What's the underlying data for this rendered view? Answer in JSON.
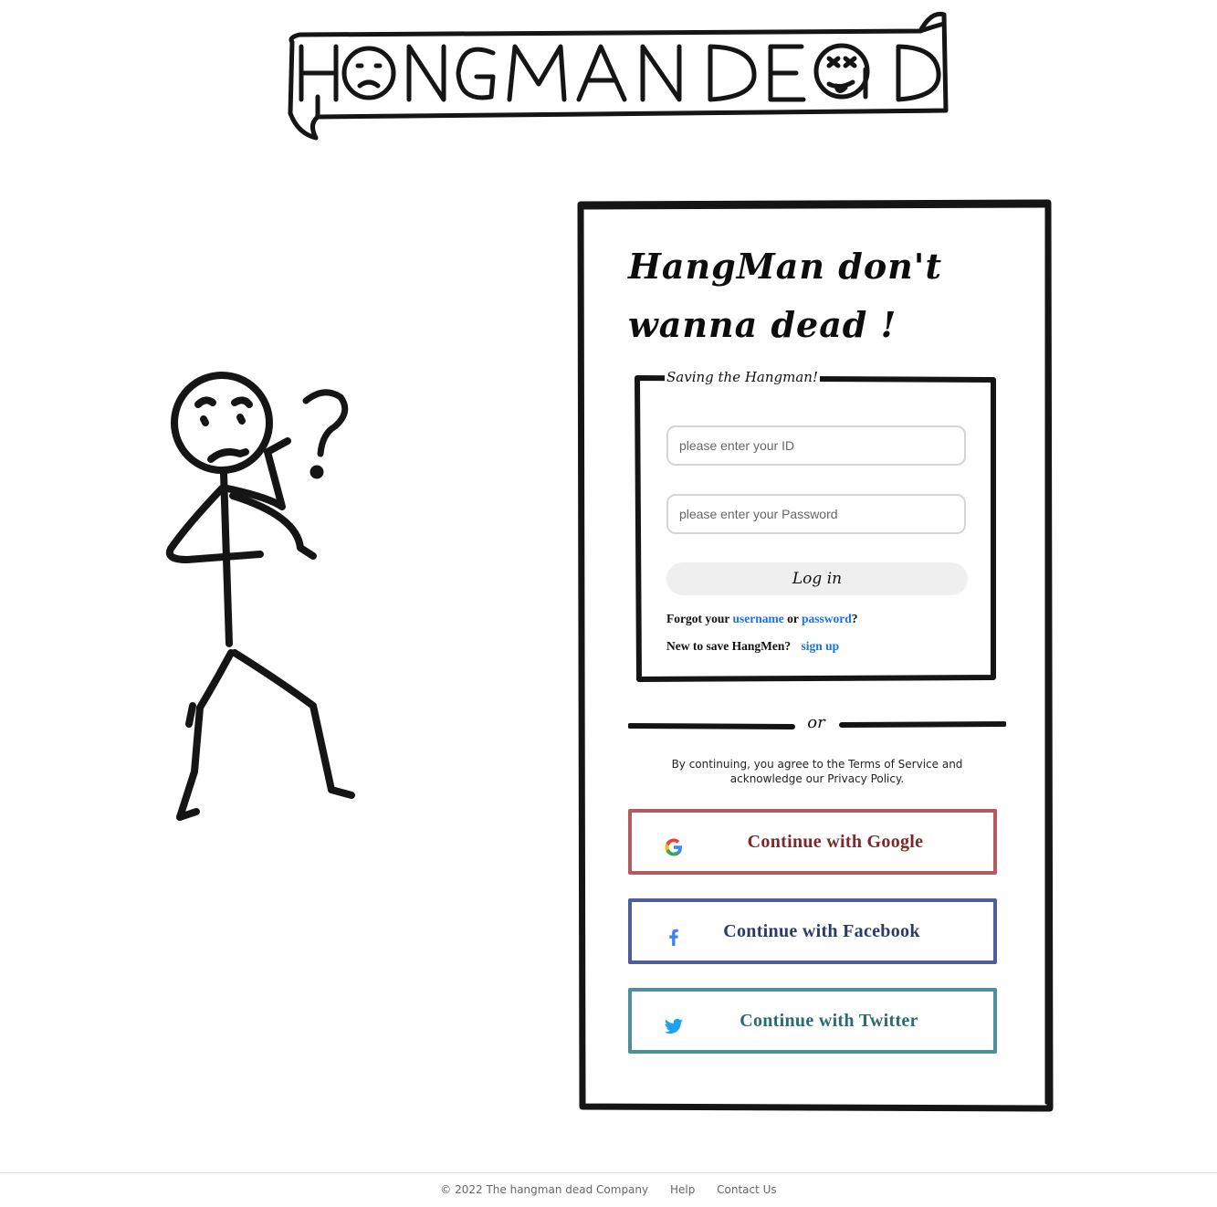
{
  "logo": {
    "text": "HANGMAN DEAD"
  },
  "login_card": {
    "headline_line1": "HangMan don't",
    "headline_line2": "wanna dead !",
    "form_legend": "Saving the Hangman!",
    "id_placeholder": "please enter your ID",
    "password_placeholder": "please enter your Password",
    "login_label": "Log in",
    "forgot_prefix": "Forgot your",
    "forgot_username": "username",
    "forgot_or": "or",
    "forgot_password": "password",
    "forgot_suffix": "?",
    "new_user_prefix": "New to save HangMen?",
    "signup_label": "sign up",
    "divider_label": "or",
    "terms_text": "By continuing, you agree to the Terms of Service and acknowledge our Privacy Policy.",
    "social": {
      "google_label": "Continue with Google",
      "facebook_label": "Continue with Facebook",
      "twitter_label": "Continue with Twitter"
    }
  },
  "footer": {
    "copyright": "© 2022 The hangman dead Company",
    "help": "Help",
    "contact": "Contact Us"
  },
  "colors": {
    "google": "#b35b5e",
    "facebook": "#4e5e9c",
    "twitter": "#4f8f98",
    "link": "#1a73e8"
  }
}
